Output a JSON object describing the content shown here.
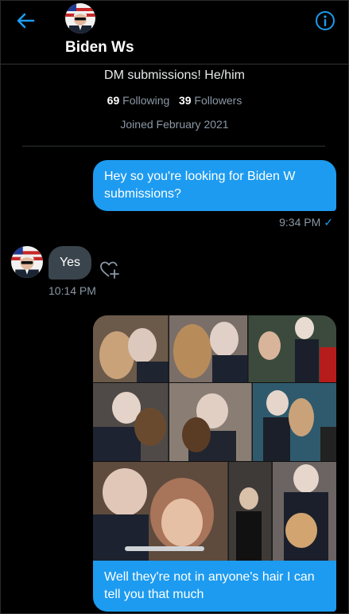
{
  "header": {
    "name": "Biden Ws",
    "back_icon": "arrow-left-icon",
    "info_icon": "info-circle-icon",
    "accent": "#1d9bf0"
  },
  "profile": {
    "bio": "DM submissions! He/him",
    "following_count": "69",
    "following_label": "Following",
    "followers_count": "39",
    "followers_label": "Followers",
    "joined": "Joined February 2021"
  },
  "messages": [
    {
      "direction": "sent",
      "text": "Hey so you're looking for Biden W submissions?",
      "time": "9:34 PM",
      "read_icon": "check-icon"
    },
    {
      "direction": "received",
      "text": "Yes",
      "time": "10:14 PM",
      "reaction_icon": "heart-plus-icon"
    },
    {
      "direction": "sent",
      "media": "photo-collage",
      "text": "Well they're not in anyone's hair I can tell you that much"
    }
  ],
  "colors": {
    "background": "#000000",
    "sent_bubble": "#1d9bf0",
    "received_bubble": "#3a444c",
    "muted_text": "#8b98a5"
  }
}
